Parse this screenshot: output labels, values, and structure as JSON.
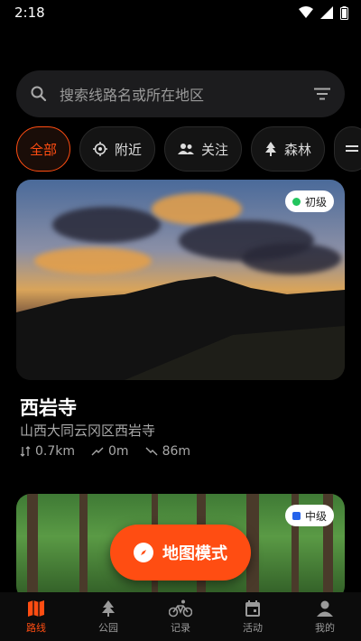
{
  "status": {
    "time": "2:18"
  },
  "search": {
    "placeholder": "搜索线路名或所在地区",
    "icon": "search-icon",
    "filter_icon": "filter-icon"
  },
  "chips": [
    {
      "label": "全部",
      "icon": "",
      "active": true
    },
    {
      "label": "附近",
      "icon": "location-icon",
      "active": false
    },
    {
      "label": "关注",
      "icon": "people-icon",
      "active": false
    },
    {
      "label": "森林",
      "icon": "tree-icon",
      "active": false
    }
  ],
  "routes": [
    {
      "title": "西岩寺",
      "location": "山西大同云冈区西岩寺",
      "difficulty": "初级",
      "difficulty_color": "#22c55e",
      "distance": "0.7km",
      "ascent": "0m",
      "elevation": "86m"
    },
    {
      "difficulty": "中级",
      "difficulty_color": "#2563eb"
    }
  ],
  "fab": {
    "label": "地图模式"
  },
  "nav": [
    {
      "label": "路线",
      "icon": "map-icon",
      "active": true
    },
    {
      "label": "公园",
      "icon": "tree-icon",
      "active": false
    },
    {
      "label": "记录",
      "icon": "bike-icon",
      "active": false
    },
    {
      "label": "活动",
      "icon": "calendar-icon",
      "active": false
    },
    {
      "label": "我的",
      "icon": "person-icon",
      "active": false
    }
  ],
  "colors": {
    "accent": "#ff4d12",
    "background": "#000000"
  }
}
